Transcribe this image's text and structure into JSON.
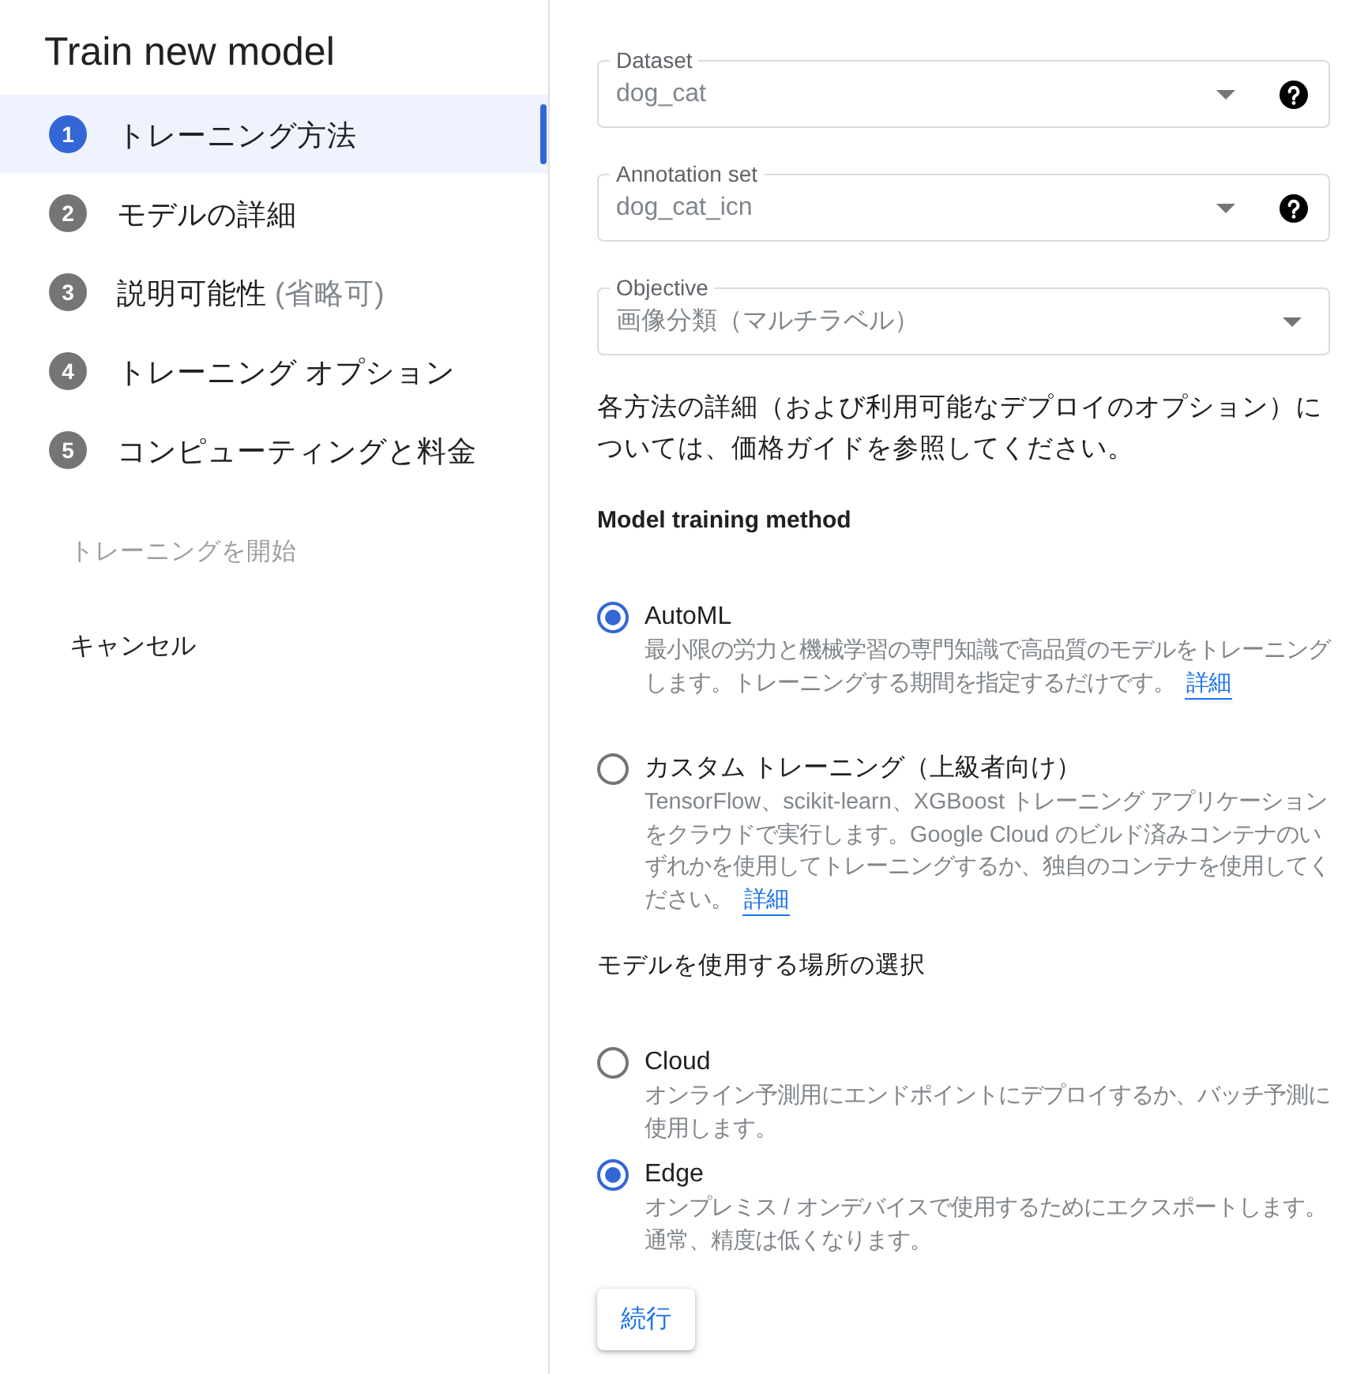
{
  "sidebar": {
    "title": "Train new model",
    "steps": [
      {
        "number": "1",
        "label": "トレーニング方法",
        "selected": true
      },
      {
        "number": "2",
        "label": "モデルの詳細",
        "selected": false
      },
      {
        "number": "3",
        "label": "説明可能性",
        "note": "(省略可)",
        "selected": false
      },
      {
        "number": "4",
        "label": "トレーニング オプション",
        "selected": false
      },
      {
        "number": "5",
        "label": "コンピューティングと料金",
        "selected": false
      }
    ],
    "actions": [
      {
        "label": "トレーニングを開始",
        "disabled": true
      },
      {
        "label": "キャンセル",
        "disabled": false
      }
    ]
  },
  "form": {
    "fields": [
      {
        "label": "Dataset",
        "value": "dog_cat",
        "disabled": true,
        "help": true
      },
      {
        "label": "Annotation set",
        "value": "dog_cat_icn",
        "disabled": true,
        "help": true
      },
      {
        "label": "Objective",
        "value": "画像分類（マルチラベル）",
        "disabled": true,
        "help": false
      }
    ],
    "info_text": "各方法の詳細（および利用可能なデプロイのオプション）については、価格ガイドを参照してください。",
    "sections": [
      {
        "heading": "Model training method",
        "options": [
          {
            "label": "AutoML",
            "description": "最小限の労力と機械学習の専門知識で高品質のモデルをトレーニングします。トレーニングする期間を指定するだけです。",
            "link": "詳細",
            "selected": true
          },
          {
            "label": "カスタム トレーニング（上級者向け）",
            "description": "TensorFlow、scikit-learn、XGBoost トレーニング アプリケーションをクラウドで実行します。Google Cloud のビルド済みコンテナのいずれかを使用してトレーニングするか、独自のコンテナを使用してください。",
            "link": "詳細",
            "selected": false
          }
        ]
      },
      {
        "heading": "モデルを使用する場所の選択",
        "options": [
          {
            "label": "Cloud",
            "description": "オンライン予測用にエンドポイントにデプロイするか、バッチ予測に使用します。",
            "selected": false
          },
          {
            "label": "Edge",
            "description": "オンプレミス / オンデバイスで使用するためにエクスポートします。通常、精度は低くなります。",
            "selected": true
          }
        ]
      }
    ],
    "continue_button": "続行"
  }
}
